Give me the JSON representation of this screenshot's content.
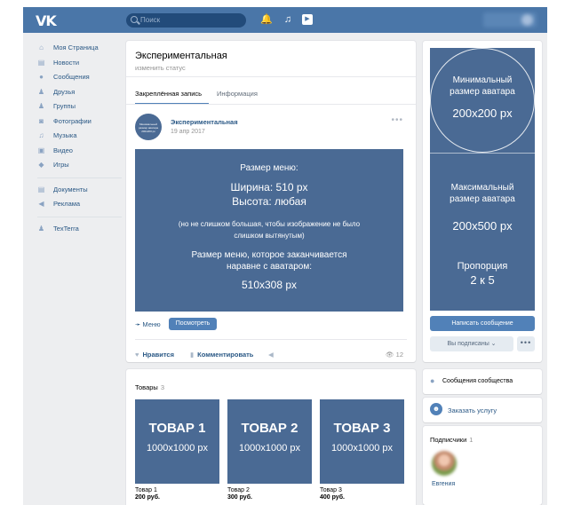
{
  "topbar": {
    "logo": "VK",
    "search_placeholder": "Поиск",
    "bell_icon": "bell-icon",
    "music_icon": "music-icon",
    "play_icon": "play-icon"
  },
  "sidebar": {
    "items": [
      {
        "icon": "⌂",
        "label": "Моя Страница"
      },
      {
        "icon": "▤",
        "label": "Новости"
      },
      {
        "icon": "●",
        "label": "Сообщения"
      },
      {
        "icon": "♟",
        "label": "Друзья"
      },
      {
        "icon": "♟",
        "label": "Группы"
      },
      {
        "icon": "◙",
        "label": "Фотографии"
      },
      {
        "icon": "♫",
        "label": "Музыка"
      },
      {
        "icon": "▣",
        "label": "Видео"
      },
      {
        "icon": "◆",
        "label": "Игры"
      }
    ],
    "items2": [
      {
        "icon": "▤",
        "label": "Документы"
      },
      {
        "icon": "◀",
        "label": "Реклама"
      }
    ],
    "items3": [
      {
        "icon": "♟",
        "label": "TexTerra"
      }
    ]
  },
  "group": {
    "title": "Экспериментальная",
    "status": "изменить статус",
    "tabs": [
      "Закреплённая запись",
      "Информация"
    ]
  },
  "post": {
    "avatar_text": "Минимальный размер аватара 200x200 px",
    "author": "Экспериментальная",
    "date": "19 апр 2017",
    "menu_image": {
      "line1": "Размер меню:",
      "line2": "Ширина: 510 px",
      "line3": "Высота: любая",
      "line4": "(но не слишком большая, чтобы изображение не было",
      "line5": "слишком вытянутым)",
      "line6": "Размер меню, которое заканчивается",
      "line7": "наравне с аватаром:",
      "line8": "510x308 px"
    },
    "menu_link": "Меню",
    "view_button": "Посмотреть",
    "like": "Нравится",
    "comment": "Комментировать",
    "views": "12"
  },
  "goods": {
    "header": "Товары",
    "count": "3",
    "items": [
      {
        "title": "ТОВАР 1",
        "size": "1000x1000 px",
        "name": "Товар 1",
        "price": "200 руб."
      },
      {
        "title": "ТОВАР 2",
        "size": "1000x1000 px",
        "name": "Товар 2",
        "price": "300 руб."
      },
      {
        "title": "ТОВАР 3",
        "size": "1000x1000 px",
        "name": "Товар 3",
        "price": "400 руб."
      }
    ]
  },
  "avatar_panel": {
    "min_line1": "Минимальный",
    "min_line2": "размер аватара",
    "min_size": "200x200 px",
    "max_line1": "Максимальный",
    "max_line2": "размер аватара",
    "max_size": "200x500 px",
    "ratio_label": "Пропорция",
    "ratio_value": "2 к 5"
  },
  "actions": {
    "write_message": "Написать сообщение",
    "subscribed": "Вы подписаны ⌄",
    "more": "•••"
  },
  "community_messages": "Сообщения сообщества",
  "order_service": "Заказать услугу",
  "subscribers": {
    "header": "Подписчики",
    "count": "1",
    "name": "Евгения"
  },
  "colors": {
    "topbar": "#4a76a8",
    "accent": "#5181b8",
    "placeholder_blue": "#4a6a94",
    "background": "#edeef0"
  }
}
